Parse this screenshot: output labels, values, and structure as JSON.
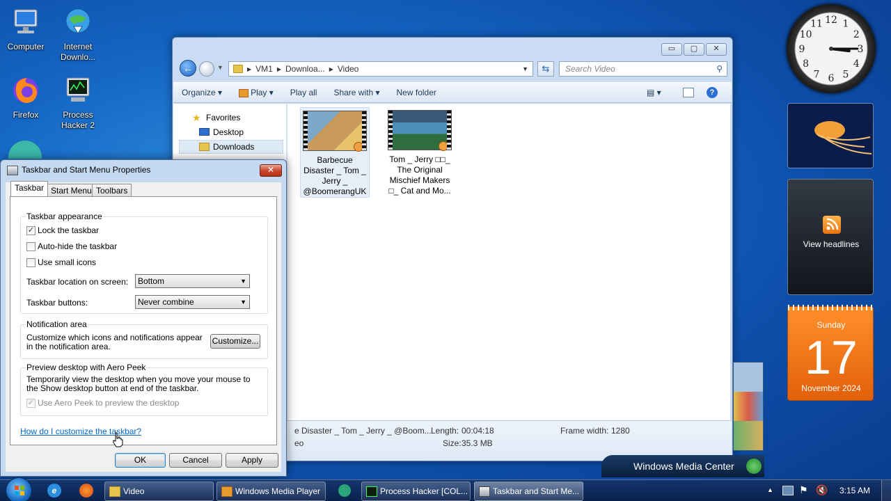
{
  "desktop": {
    "icons": [
      {
        "label": "Computer"
      },
      {
        "label": "Internet Downlo..."
      },
      {
        "label": "Firefox"
      },
      {
        "label": "Process Hacker 2"
      }
    ]
  },
  "explorer": {
    "address": {
      "parts": [
        "VM1",
        "Downloa...",
        "Video"
      ]
    },
    "search_placeholder": "Search Video",
    "caption": {
      "minimize": "▭",
      "maximize": "▢",
      "close": "✕"
    },
    "toolbar": {
      "organize": "Organize",
      "play": "Play",
      "play_all": "Play all",
      "share_with": "Share with",
      "new_folder": "New folder"
    },
    "nav": {
      "favorites": "Favorites",
      "desktop": "Desktop",
      "downloads": "Downloads"
    },
    "files": [
      {
        "name": "Barbecue Disaster _ Tom _ Jerry _ @BoomerangUK"
      },
      {
        "name": "Tom _ Jerry □□_ The Original Mischief Makers □_ Cat and Mo..."
      }
    ],
    "details": {
      "name": "e Disaster _ Tom _ Jerry _ @Boom...",
      "type_fragment": "eo",
      "length_label": "Length:",
      "length_value": "00:04:18",
      "size_label": "Size:",
      "size_value": "35.3 MB",
      "frame_width_label": "Frame width:",
      "frame_width_value": "1280"
    }
  },
  "dialog": {
    "title": "Taskbar and Start Menu Properties",
    "close": "✕",
    "tabs": [
      "Taskbar",
      "Start Menu",
      "Toolbars"
    ],
    "appearance": {
      "legend": "Taskbar appearance",
      "lock": "Lock the taskbar",
      "lock_checked": true,
      "autohide": "Auto-hide the taskbar",
      "small_icons": "Use small icons",
      "location_label": "Taskbar location on screen:",
      "location_value": "Bottom",
      "buttons_label": "Taskbar buttons:",
      "buttons_value": "Never combine"
    },
    "notification": {
      "legend": "Notification area",
      "text": "Customize which icons and notifications appear in the notification area.",
      "customize": "Customize..."
    },
    "aero": {
      "legend": "Preview desktop with Aero Peek",
      "text": "Temporarily view the desktop when you move your mouse to the Show desktop button at end of the taskbar.",
      "checkbox": "Use Aero Peek to preview the desktop"
    },
    "help_link": "How do I customize the taskbar?",
    "buttons": {
      "ok": "OK",
      "cancel": "Cancel",
      "apply": "Apply"
    }
  },
  "gadgets": {
    "clock_numbers": [
      "12",
      "1",
      "2",
      "3",
      "4",
      "5",
      "6",
      "7",
      "8",
      "9",
      "10",
      "11"
    ],
    "headlines": "View headlines",
    "calendar": {
      "weekday": "Sunday",
      "day": "17",
      "month_year": "November 2024"
    }
  },
  "media_center": {
    "label": "Windows Media Center"
  },
  "taskbar": {
    "buttons": [
      {
        "label": "Video"
      },
      {
        "label": "Windows Media Player"
      },
      {
        "label": "Process Hacker [COL..."
      },
      {
        "label": "Taskbar and Start Me..."
      }
    ],
    "time": "3:15 AM"
  },
  "colors": {
    "accent": "#1566c4",
    "calendar": "#e8670c",
    "link": "#0066cc"
  }
}
